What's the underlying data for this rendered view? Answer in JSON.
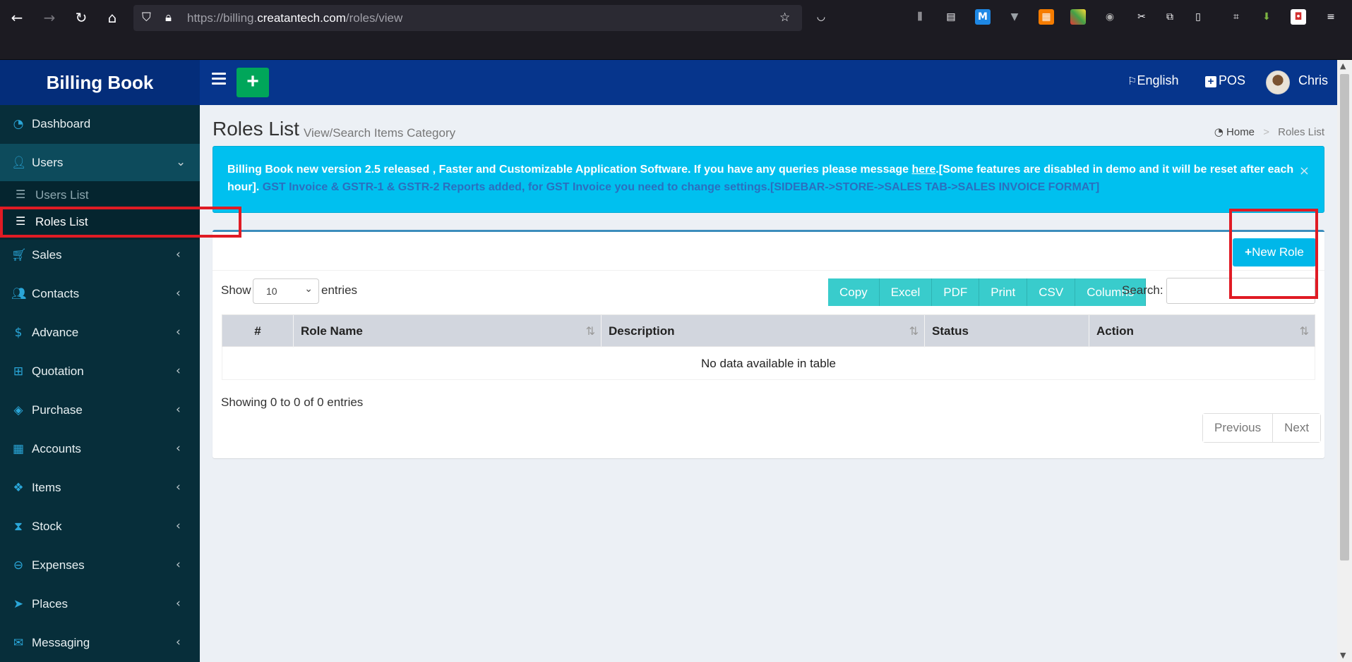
{
  "browser": {
    "url_prefix": "https://billing.",
    "url_domain": "creatantech.com",
    "url_path": "/roles/view"
  },
  "app": {
    "logo": "Billing Book",
    "language": "English",
    "pos_label": "POS",
    "user_name": "Chris"
  },
  "sidebar": {
    "items": [
      {
        "label": "Dashboard",
        "icon": "dashboard-icon"
      },
      {
        "label": "Users",
        "icon": "users-icon"
      },
      {
        "label": "Sales",
        "icon": "cart-icon"
      },
      {
        "label": "Contacts",
        "icon": "contacts-icon"
      },
      {
        "label": "Advance",
        "icon": "dollar-icon"
      },
      {
        "label": "Quotation",
        "icon": "calendar-plus-icon"
      },
      {
        "label": "Purchase",
        "icon": "cube-icon"
      },
      {
        "label": "Accounts",
        "icon": "grid-icon"
      },
      {
        "label": "Items",
        "icon": "cubes-icon"
      },
      {
        "label": "Stock",
        "icon": "hourglass-icon"
      },
      {
        "label": "Expenses",
        "icon": "minus-circle-icon"
      },
      {
        "label": "Places",
        "icon": "paper-plane-icon"
      },
      {
        "label": "Messaging",
        "icon": "envelope-icon"
      }
    ],
    "users_sub": [
      {
        "label": "Users List"
      },
      {
        "label": "Roles List"
      }
    ]
  },
  "page": {
    "title": "Roles List",
    "subtitle": "View/Search Items Category",
    "breadcrumb_home": "Home",
    "breadcrumb_current": "Roles List"
  },
  "alert": {
    "part1": "Billing Book new version 2.5 released , Faster and Customizable Application Software. If you have any queries please message ",
    "link": "here",
    "part2": ".[Some features are disabled in demo and it will be reset after each hour].",
    "part3": " GST Invoice & GSTR-1 & GSTR-2 Reports added, for GST Invoice you need to change settings.[SIDEBAR->STORE->SALES TAB->SALES INVOICE FORMAT]",
    "close": "×"
  },
  "box": {
    "new_role": "New Role"
  },
  "table_controls": {
    "show": "Show",
    "entries_value": "10",
    "entries": "entries",
    "buttons": [
      "Copy",
      "Excel",
      "PDF",
      "Print",
      "CSV",
      "Columns"
    ],
    "search_label": "Search:"
  },
  "table": {
    "columns": [
      "#",
      "Role Name",
      "Description",
      "Status",
      "Action"
    ],
    "empty": "No data available in table",
    "info": "Showing 0 to 0 of 0 entries",
    "previous": "Previous",
    "next": "Next"
  },
  "colors": {
    "header_bg": "#06358c",
    "sidebar_bg": "#072e3a",
    "alert_bg": "#00c0ef",
    "dt_button": "#39cccc",
    "highlight": "#e01b24"
  }
}
